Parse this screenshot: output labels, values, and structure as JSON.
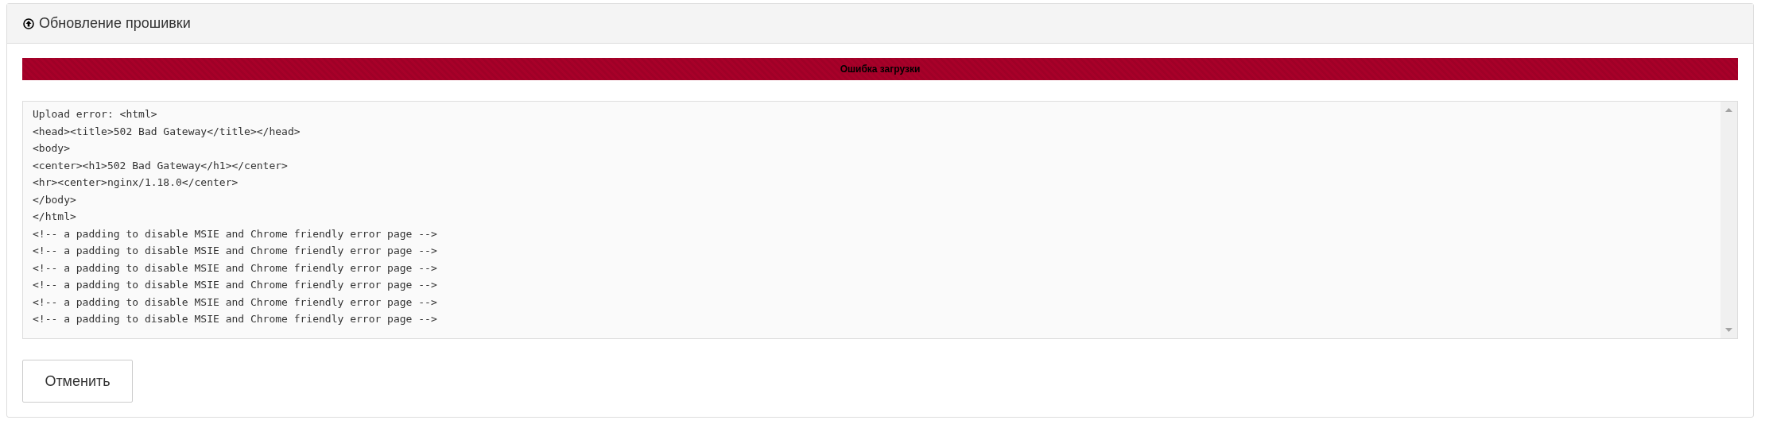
{
  "panel": {
    "title": "Обновление прошивки"
  },
  "progress": {
    "label": "Ошибка загрузки",
    "level": 1
  },
  "log": {
    "value": "Upload error: <html>\n<head><title>502 Bad Gateway</title></head>\n<body>\n<center><h1>502 Bad Gateway</h1></center>\n<hr><center>nginx/1.18.0</center>\n</body>\n</html>\n<!-- a padding to disable MSIE and Chrome friendly error page -->\n<!-- a padding to disable MSIE and Chrome friendly error page -->\n<!-- a padding to disable MSIE and Chrome friendly error page -->\n<!-- a padding to disable MSIE and Chrome friendly error page -->\n<!-- a padding to disable MSIE and Chrome friendly error page -->\n<!-- a padding to disable MSIE and Chrome friendly error page -->"
  },
  "buttons": [
    {
      "label": "Отменить"
    }
  ]
}
